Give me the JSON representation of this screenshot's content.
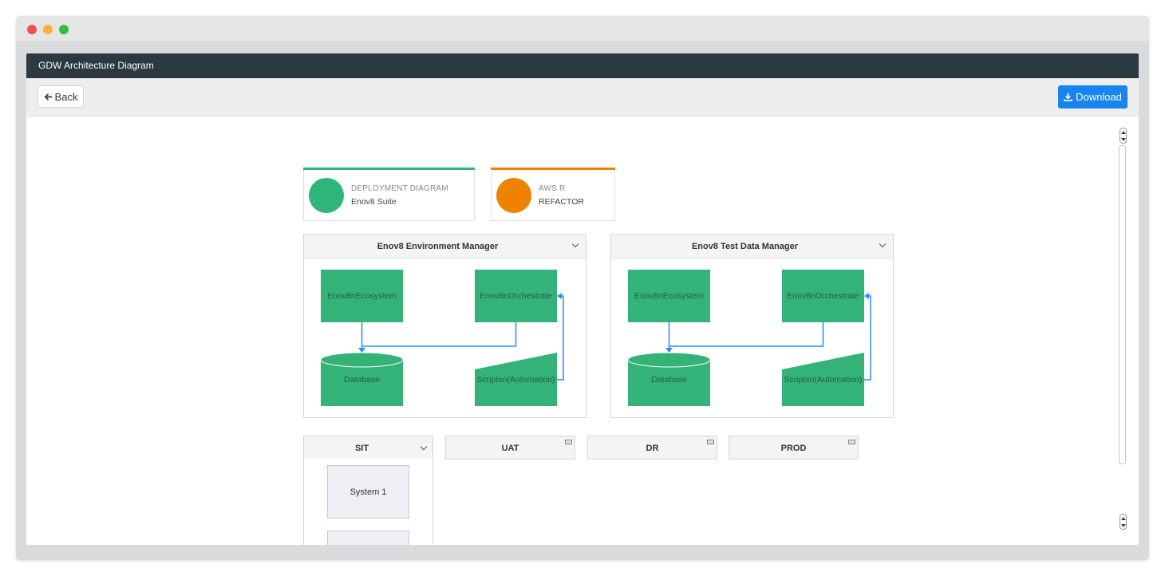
{
  "window": {
    "controls": [
      "close",
      "minimize",
      "maximize"
    ]
  },
  "header": {
    "title": "GDW Architecture Diagram"
  },
  "toolbar": {
    "back_label": "Back",
    "back_icon": "arrow-left-icon",
    "download_label": "Download",
    "download_icon": "download-icon"
  },
  "cards": [
    {
      "label": "DEPLOYMENT DIAGRAM",
      "value": "Enov8 Suite",
      "color": "#2fb678"
    },
    {
      "label": "AWS R",
      "value": "REFACTOR",
      "color": "#ef8200"
    }
  ],
  "panels": [
    {
      "title": "Enov8 Environment Manager",
      "nodes": {
        "ecosystem": "Enov8nEcosystem",
        "orchestrate": "Enov8nOrchestrate",
        "database": "Database",
        "scripts": "Scriptsn(Automation)"
      }
    },
    {
      "title": "Enov8 Test Data Manager",
      "nodes": {
        "ecosystem": "Enov8nEcosystem",
        "orchestrate": "Enov8nOrchestrate",
        "database": "Database",
        "scripts": "Scriptsn(Automation)"
      }
    }
  ],
  "environments": [
    {
      "label": "SIT",
      "expanded": true
    },
    {
      "label": "UAT",
      "expanded": false
    },
    {
      "label": "DR",
      "expanded": false
    },
    {
      "label": "PROD",
      "expanded": false
    }
  ],
  "systems": [
    "System 1",
    ""
  ],
  "colors": {
    "node": "#33b377",
    "connector": "#2b8cf0",
    "header": "#2b3940",
    "primary": "#1884f0"
  }
}
